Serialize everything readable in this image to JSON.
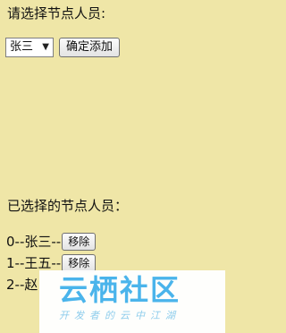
{
  "prompt": {
    "label": "请选择节点人员:"
  },
  "picker": {
    "selected_value": "张三",
    "add_button_label": "确定添加"
  },
  "selected": {
    "title": "已选择的节点人员：",
    "items": [
      {
        "label": "0--张三--",
        "remove_label": "移除"
      },
      {
        "label": "1--王五--",
        "remove_label": "移除"
      },
      {
        "label": "2--赵"
      }
    ]
  },
  "watermark": {
    "main": "云栖社区",
    "sub": "开发者的云中江湖"
  },
  "colors": {
    "background": "#efe6a7",
    "watermark_blue": "#45b3ee"
  }
}
